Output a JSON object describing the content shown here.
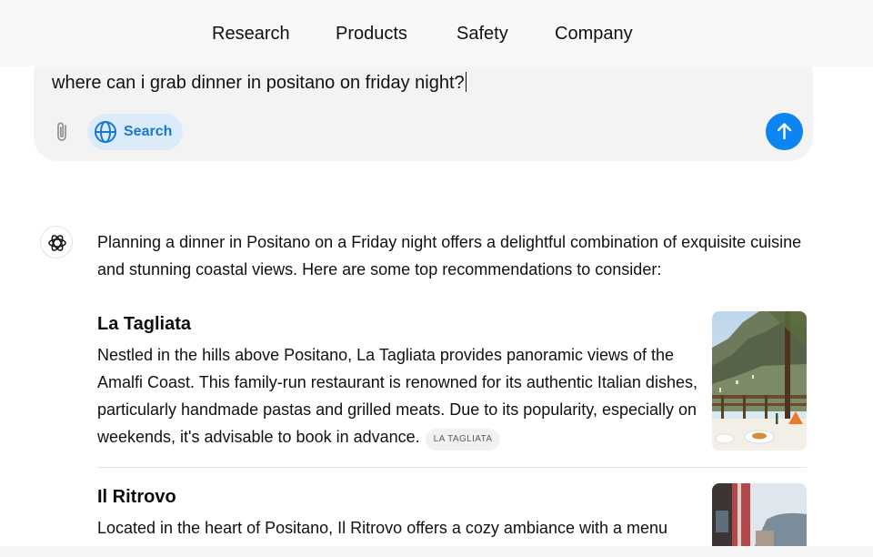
{
  "nav": {
    "items": [
      {
        "label": "Research"
      },
      {
        "label": "Products"
      },
      {
        "label": "Safety"
      },
      {
        "label": "Company"
      }
    ]
  },
  "composer": {
    "text": "where can i grab dinner in positano on friday night?",
    "search_label": "Search",
    "icons": {
      "attach": "paperclip-icon",
      "search": "globe-icon",
      "send": "arrow-up-icon"
    }
  },
  "response": {
    "avatar_icon": "openai-logo-icon",
    "intro": "Planning a dinner in Positano on a Friday night offers a delightful combination of exquisite cuisine and stunning coastal views. Here are some top recommendations to consider:",
    "restaurants": [
      {
        "name": "La Tagliata",
        "description": "Nestled in the hills above Positano, La Tagliata provides panoramic views of the Amalfi Coast. This family-run restaurant is renowned for its authentic Italian dishes, particularly handmade pastas and grilled meats. Due to its popularity, especially on weekends, it's advisable to book in advance.",
        "source": "LA TAGLIATA"
      },
      {
        "name": "Il Ritrovo",
        "description": "Located in the heart of Positano, Il Ritrovo offers a cozy ambiance with a menu"
      }
    ]
  },
  "colors": {
    "accent": "#0d85f0",
    "chip_bg": "#dcebfa",
    "chip_text": "#1877d3",
    "composer_bg": "#f3f3f3",
    "nav_bg": "#f8f8f8"
  }
}
